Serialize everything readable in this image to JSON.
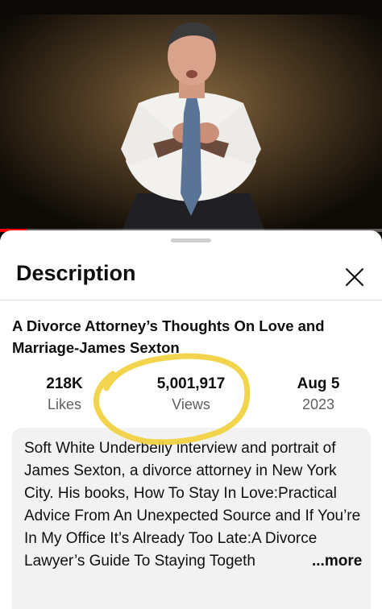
{
  "video": {
    "progress": 0.07,
    "progress_color": "#ff0000"
  },
  "sheet": {
    "title": "Description",
    "close_icon": "close-icon"
  },
  "video_title": "A Divorce Attorney’s Thoughts On Love and Marriage-James Sexton",
  "stats": {
    "likes_value": "218K",
    "likes_label": "Likes",
    "views_value": "5,001,917",
    "views_label": "Views",
    "date_value": "Aug 5",
    "date_year": "2023"
  },
  "description": {
    "text": "Soft White Underbelly interview and portrait of James Sexton, a divorce attorney in New York City. His books, How To Stay In Love:Practical Advice From An Unexpected Source and If You’re In My Office It’s Already Too Late:A Divorce Lawyer’s Guide To Staying Togeth",
    "more_label": "...more"
  },
  "annotation": {
    "highlight_color": "#f2cf3a"
  }
}
